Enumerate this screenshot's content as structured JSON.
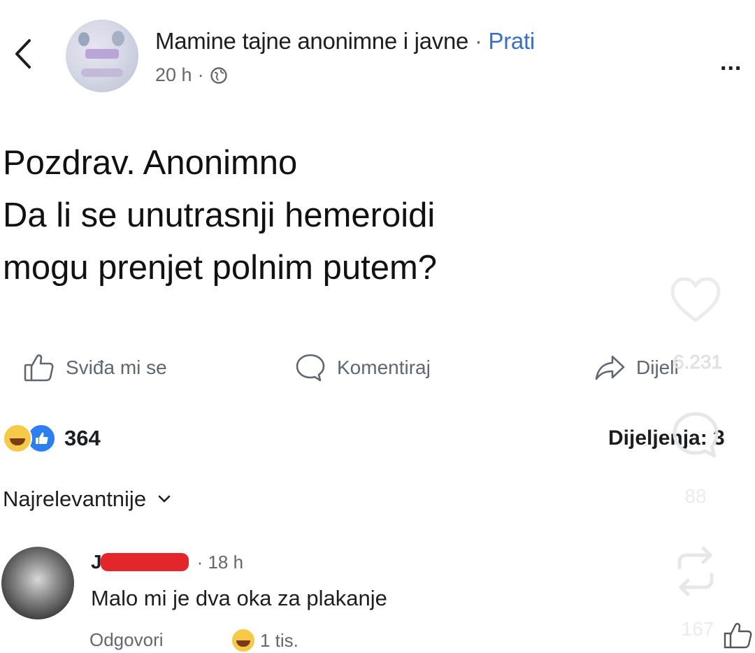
{
  "header": {
    "page_name": "Mamine tajne anonimne i javne",
    "separator": "·",
    "follow_label": "Prati",
    "time": "20 h",
    "time_separator": "·",
    "more_label": "..."
  },
  "post": {
    "lines": [
      "Pozdrav. Anonimno",
      "Da li se unutrasnji hemeroidi",
      "mogu prenjet polnim putem?"
    ]
  },
  "actions": {
    "like_label": "Sviđa mi se",
    "comment_label": "Komentiraj",
    "share_label": "Dijeli"
  },
  "reactions": {
    "count": "364",
    "shares_label": "Dijeljenja: 3"
  },
  "comments_sort": {
    "label": "Najrelevantnije"
  },
  "comment": {
    "author_initial": "J",
    "time": "· 18 h",
    "text": "Malo mi je dva oka za plakanje",
    "reply_label": "Odgovori",
    "reaction_count": "1 tis."
  },
  "overlay": {
    "likes": "6.231",
    "comments": "88",
    "reposts": "167"
  },
  "colors": {
    "follow": "#3b6fbf",
    "like_reaction": "#2d7ff0",
    "haha_reaction": "#f7c948",
    "redaction": "#e3262b"
  }
}
